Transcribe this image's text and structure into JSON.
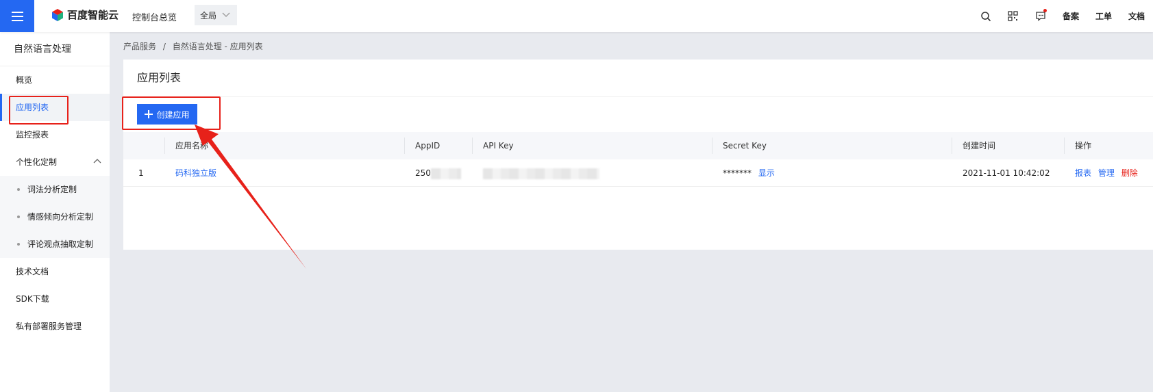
{
  "topbar": {
    "logo_text": "百度智能云",
    "console_link": "控制台总览",
    "region": "全局",
    "links": [
      "备案",
      "工单",
      "文档"
    ]
  },
  "sidebar": {
    "title": "自然语言处理",
    "items": [
      {
        "label": "概览"
      },
      {
        "label": "应用列表",
        "active": true
      }
    ],
    "item_monitor": "监控报表",
    "group": {
      "label": "个性化定制",
      "children": [
        "词法分析定制",
        "情感倾向分析定制",
        "评论观点抽取定制"
      ]
    },
    "bottom_items": [
      "技术文档",
      "SDK下载",
      "私有部署服务管理"
    ]
  },
  "breadcrumb": {
    "root": "产品服务",
    "separator": "/",
    "current": "自然语言处理 - 应用列表"
  },
  "main": {
    "title": "应用列表",
    "create_button": "创建应用",
    "table": {
      "headers": [
        "",
        "应用名称",
        "AppID",
        "API Key",
        "Secret Key",
        "创建时间",
        "操作"
      ],
      "rows": [
        {
          "index": "1",
          "name": "码科独立版",
          "app_id_prefix": "250",
          "secret_mask": "*******",
          "show_label": "显示",
          "created": "2021-11-01 10:42:02",
          "actions": {
            "report": "报表",
            "manage": "管理",
            "delete": "删除"
          }
        }
      ]
    }
  },
  "colors": {
    "brand_blue": "#2468f2",
    "danger_red": "#e7211a",
    "annotation_red": "#e7211a"
  }
}
